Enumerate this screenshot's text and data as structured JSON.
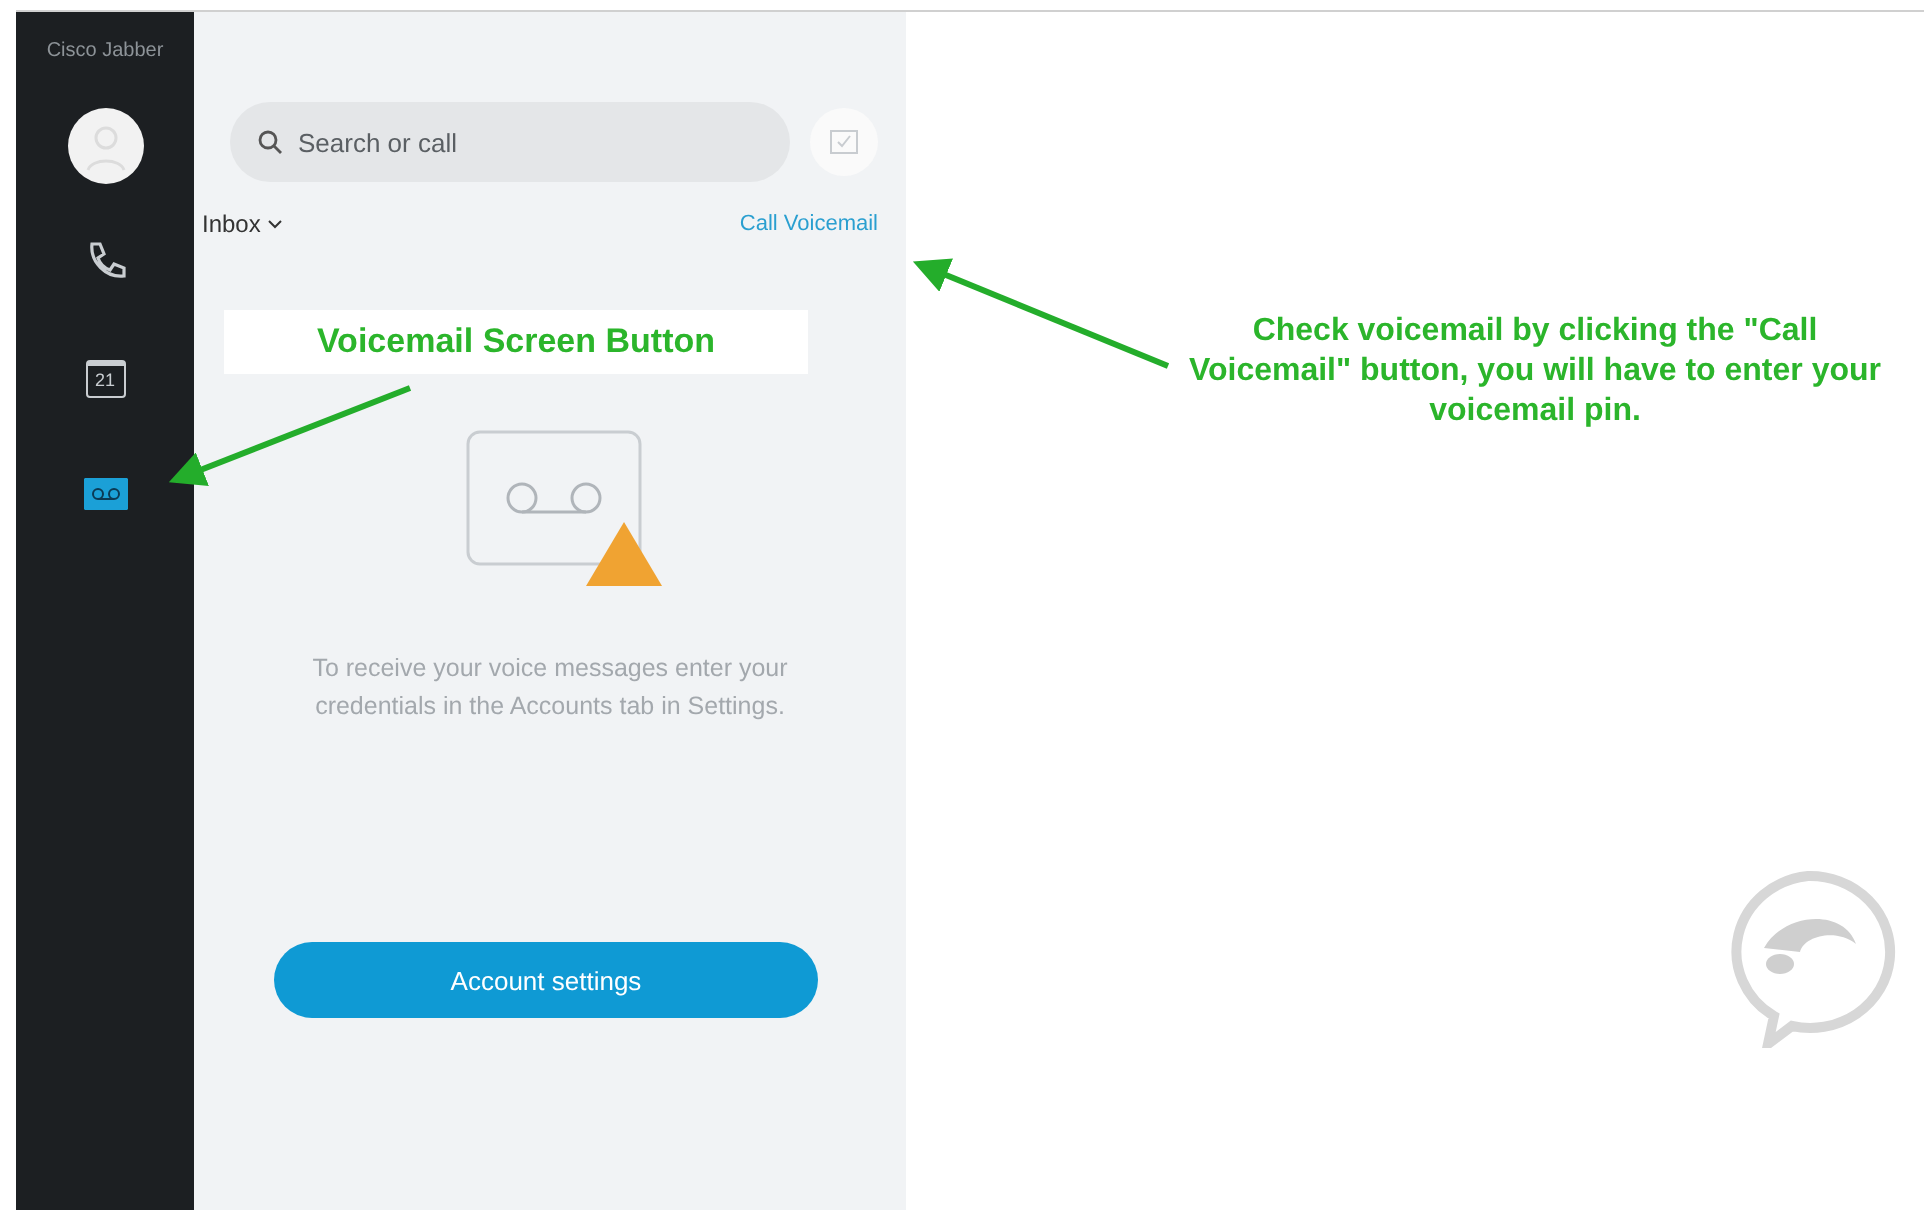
{
  "app": {
    "title": "Cisco Jabber"
  },
  "nav": [
    {
      "kind": "avatar",
      "selected": false
    },
    {
      "kind": "phone",
      "selected": false
    },
    {
      "kind": "calendar",
      "label": "21",
      "selected": false
    },
    {
      "kind": "voicemail",
      "selected": true
    }
  ],
  "search": {
    "placeholder": "Search or call"
  },
  "inbox": {
    "label": "Inbox",
    "action": "Call Voicemail"
  },
  "empty_state": {
    "message": "To receive your voice messages enter your credentials in the Accounts tab in Settings.",
    "button": "Account settings"
  },
  "annotations": [
    {
      "text": "Voicemail Screen Button"
    },
    {
      "text": "Check voicemail by clicking the \"Call Voicemail\" button, you will have to enter your voicemail pin."
    }
  ]
}
